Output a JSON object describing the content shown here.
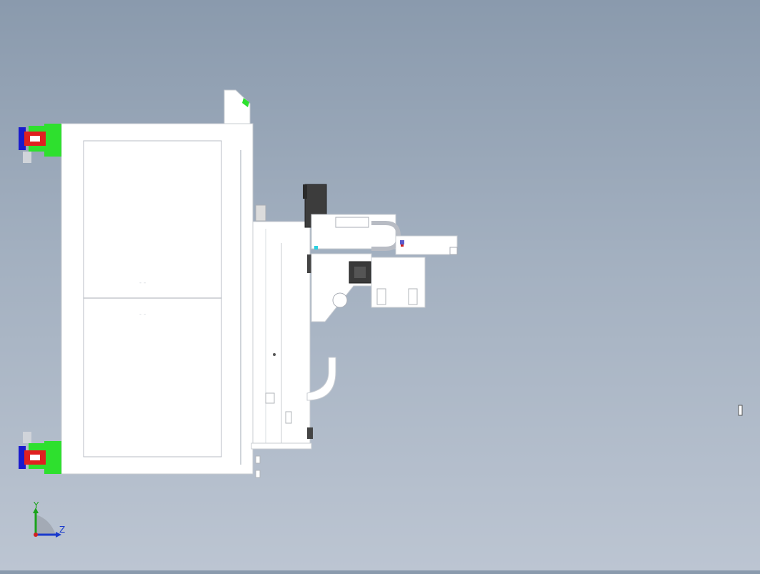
{
  "viewport": {
    "background_top": "#8a9aad",
    "background_bottom": "#bcc5d2"
  },
  "triad": {
    "y_label": "Y",
    "z_label": "Z",
    "y_color": "#1aa31a",
    "z_color": "#1a3acc",
    "origin_color": "#d12020"
  },
  "model": {
    "body_color": "#ffffff",
    "edge_color": "#c8ccd2",
    "motor_color": "#3c3c3c",
    "caster_colors": {
      "bracket": "#2ee02e",
      "wheel": "#e02020",
      "hub": "#1a1acc"
    }
  }
}
